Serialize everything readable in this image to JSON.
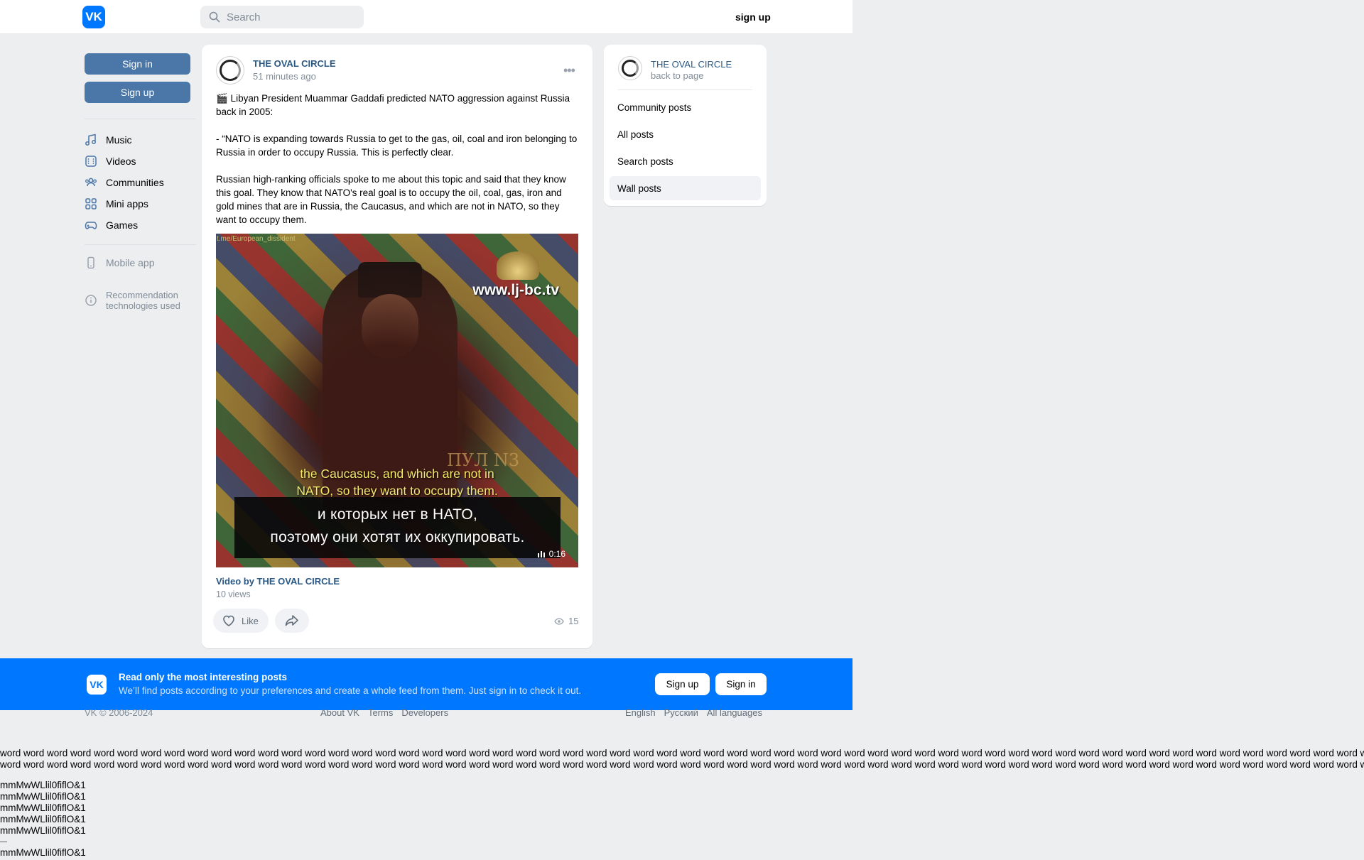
{
  "header": {
    "logo_text": "VK",
    "search_placeholder": "Search",
    "signup_label": "sign up"
  },
  "left_nav": {
    "signin_label": "Sign in",
    "signup_label": "Sign up",
    "items": [
      {
        "label": "Music",
        "icon": "music-icon"
      },
      {
        "label": "Videos",
        "icon": "video-icon"
      },
      {
        "label": "Communities",
        "icon": "communities-icon"
      },
      {
        "label": "Mini apps",
        "icon": "mini-apps-icon"
      },
      {
        "label": "Games",
        "icon": "games-icon"
      }
    ],
    "mobile_app_label": "Mobile app",
    "recommendation_label": "Recommendation technologies used"
  },
  "post": {
    "author": "THE OVAL CIRCLE",
    "time": "51 minutes ago",
    "paragraphs": [
      "🎬 Libyan President Muammar Gaddafi predicted NATO aggression against Russia back in 2005:",
      "- “NATO is expanding towards Russia to get to the gas, oil, coal and iron belonging to Russia in order to occupy Russia. This is perfectly clear.",
      "Russian high-ranking officials spoke to me about this topic and said that they know this goal. They know that NATO's real goal is to occupy the oil, coal, gas, iron and gold mines that are in Russia, the Caucasus, and which are not in NATO, so they want to occupy them."
    ],
    "video": {
      "watermark": "t.me/European_dissident",
      "site": "www.lj-bc.tv",
      "logo_text": "ПУЛ N3",
      "subtitle_en_1": "the Caucasus, and which are not in",
      "subtitle_en_2": "NATO, so they want to occupy them.",
      "subtitle_ru_1": "и которых нет в НАТО,",
      "subtitle_ru_2": "поэтому они хотят их оккупировать.",
      "duration": "0:16"
    },
    "video_title": "Video by THE OVAL CIRCLE",
    "video_views": "10 views",
    "like_label": "Like",
    "views_count": "15"
  },
  "right_card": {
    "name": "THE OVAL CIRCLE",
    "back_label": "back to page",
    "items": [
      "Community posts",
      "All posts",
      "Search posts",
      "Wall posts"
    ],
    "active_item": "Wall posts"
  },
  "banner": {
    "title": "Read only the most interesting posts",
    "subtitle": "We’ll find posts according to your preferences and create a whole feed from them. Just sign in to check it out.",
    "signup_label": "Sign up",
    "signin_label": "Sign in"
  },
  "footer": {
    "copyright": "VK © 2006-2024",
    "links": [
      "About VK",
      "Terms",
      "Developers"
    ],
    "languages": [
      "English",
      "Русский",
      "All languages"
    ]
  },
  "filler": {
    "word_lines": [
      "word word word word word word word word word word word word word word word word word word word word word word word word word word word word word word word word word word word word word word word word word word word word word word word word word word word word word word word word word word word wo",
      "word word word word word word word word word word word word word word word word word word word word word word word word word word word word word word word word word word word word word word word word word word word word word word word word word word word word word word word word word word word wo"
    ],
    "glyph_lines": [
      "mmMwWLlil0fiflO&1",
      "mmMwWLlil0fiflO&1",
      "mmMwWLlil0fiflO&1",
      "mmMwWLlil0fiflO&1",
      "mmMwWLlil0fiflO&1"
    ],
    "glyph_last": "mmMwWLlil0fiflO&1"
  },
  "colors": {
    "brand": "#0077ff",
    "button_blue": "#4a76a8",
    "link": "#2a5885",
    "page_bg": "#edeef0"
  }
}
